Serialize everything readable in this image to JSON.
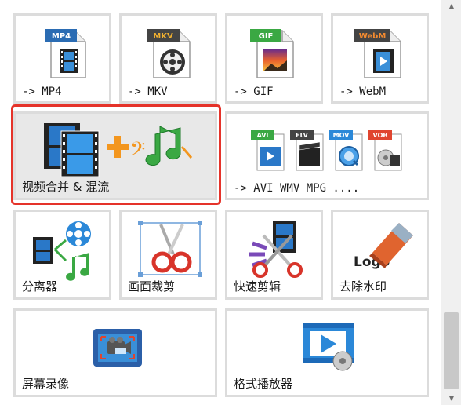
{
  "tiles": [
    {
      "label": "-> MP4",
      "badge": "MP4",
      "badge_color": "#2b6cb3",
      "icon": "mp4-file-icon"
    },
    {
      "label": "-> MKV",
      "badge": "MKV",
      "badge_color": "#444444",
      "badge_text_color": "#f2b130",
      "icon": "mkv-file-icon"
    },
    {
      "label": "-> GIF",
      "badge": "GIF",
      "badge_color": "#3aa843",
      "icon": "gif-file-icon"
    },
    {
      "label": "-> WebM",
      "badge": "WebM",
      "badge_color": "#444444",
      "badge_text_color": "#f28a30",
      "icon": "webm-file-icon"
    },
    {
      "label": "视频合并 & 混流",
      "icon": "video-merge-music-icon"
    },
    {
      "label": "-> AVI WMV MPG ....",
      "icon": "multi-format-icon",
      "formats": [
        {
          "name": "AVI",
          "color": "#3aa843"
        },
        {
          "name": "FLV",
          "color": "#444444"
        },
        {
          "name": "MOV",
          "color": "#2b88d8"
        },
        {
          "name": "VOB",
          "color": "#e0452f"
        }
      ]
    },
    {
      "label": "分离器",
      "icon": "splitter-icon"
    },
    {
      "label": "画面裁剪",
      "icon": "crop-scissors-icon"
    },
    {
      "label": "快速剪辑",
      "icon": "quick-cut-icon"
    },
    {
      "label": "去除水印",
      "icon": "remove-watermark-icon",
      "logo_text": "Logo"
    },
    {
      "label": "屏幕录像",
      "icon": "screen-record-icon"
    },
    {
      "label": "格式播放器",
      "icon": "format-player-icon"
    }
  ],
  "selected_index": 4,
  "colors": {
    "selection_border": "#e5332a",
    "tile_border": "#dcdcdc",
    "selected_bg": "#e8e8e8"
  }
}
